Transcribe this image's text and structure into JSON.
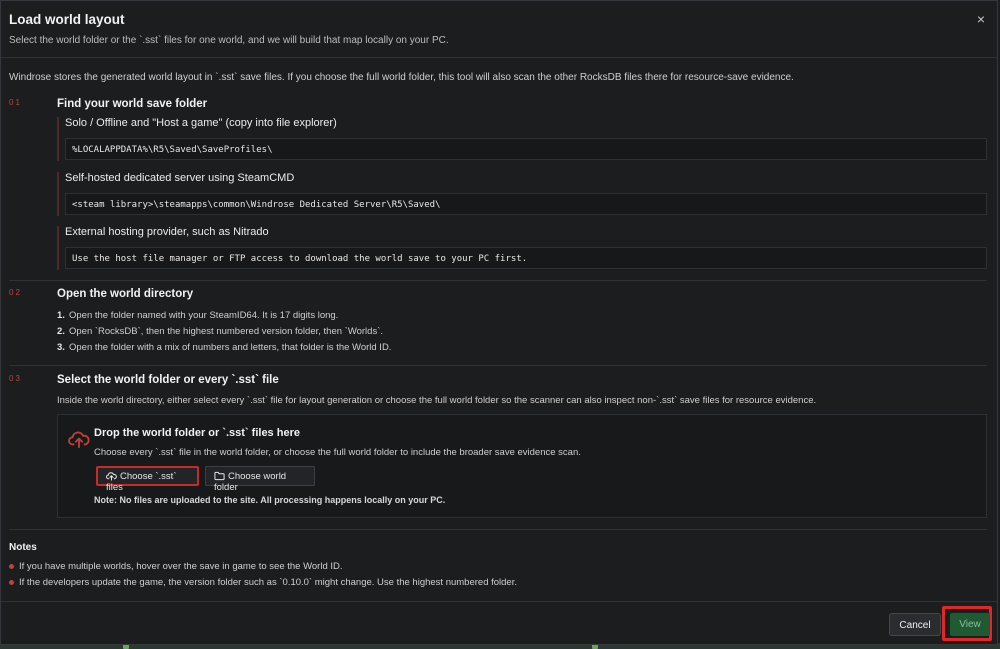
{
  "modal": {
    "title": "Load world layout",
    "subtitle": "Select the world folder or the `.sst` files for one world, and we will build that map locally on your PC.",
    "close_glyph": "×",
    "intro": "Windrose stores the generated world layout in `.sst` save files. If you choose the full world folder, this tool will also scan the other RocksDB files there for resource-save evidence."
  },
  "steps": [
    {
      "number": "01",
      "title": "Find your world save folder",
      "locations": [
        {
          "title": "Solo / Offline and \"Host a game\" (copy into file explorer)",
          "path": "%LOCALAPPDATA%\\R5\\Saved\\SaveProfiles\\"
        },
        {
          "title": "Self-hosted dedicated server using SteamCMD",
          "path": "<steam library>\\steamapps\\common\\Windrose Dedicated Server\\R5\\Saved\\"
        },
        {
          "title": "External hosting provider, such as Nitrado",
          "path": "Use the host file manager or FTP access to download the world save to your PC first."
        }
      ]
    },
    {
      "number": "02",
      "title": "Open the world directory",
      "items": [
        "Open the folder named with your SteamID64. It is 17 digits long.",
        "Open `RocksDB`, then the highest numbered version folder, then `Worlds`.",
        "Open the folder with a mix of numbers and letters, that folder is the World ID."
      ]
    },
    {
      "number": "03",
      "title": "Select the world folder or every `.sst` file",
      "description": "Inside the world directory, either select every `.sst` file for layout generation or choose the full world folder so the scanner can also inspect non-`.sst` save files for resource evidence."
    }
  ],
  "dropzone": {
    "title": "Drop the world folder or `.sst` files here",
    "description": "Choose every `.sst` file in the world folder, or choose the full world folder to include the broader save evidence scan.",
    "choose_sst_label": "Choose `.sst` files",
    "choose_folder_label": "Choose world folder",
    "note": "Note: No files are uploaded to the site. All processing happens locally on your PC."
  },
  "notes": {
    "title": "Notes",
    "items": [
      "If you have multiple worlds, hover over the save in game to see the World ID.",
      "If the developers update the game, the version folder such as `0.10.0` might change. Use the highest numbered folder."
    ]
  },
  "footer": {
    "cancel_label": "Cancel",
    "view_label": "View"
  },
  "colors": {
    "accent_red": "#c0413a",
    "highlight_red": "#e32626",
    "view_green": "#1f5a33"
  }
}
